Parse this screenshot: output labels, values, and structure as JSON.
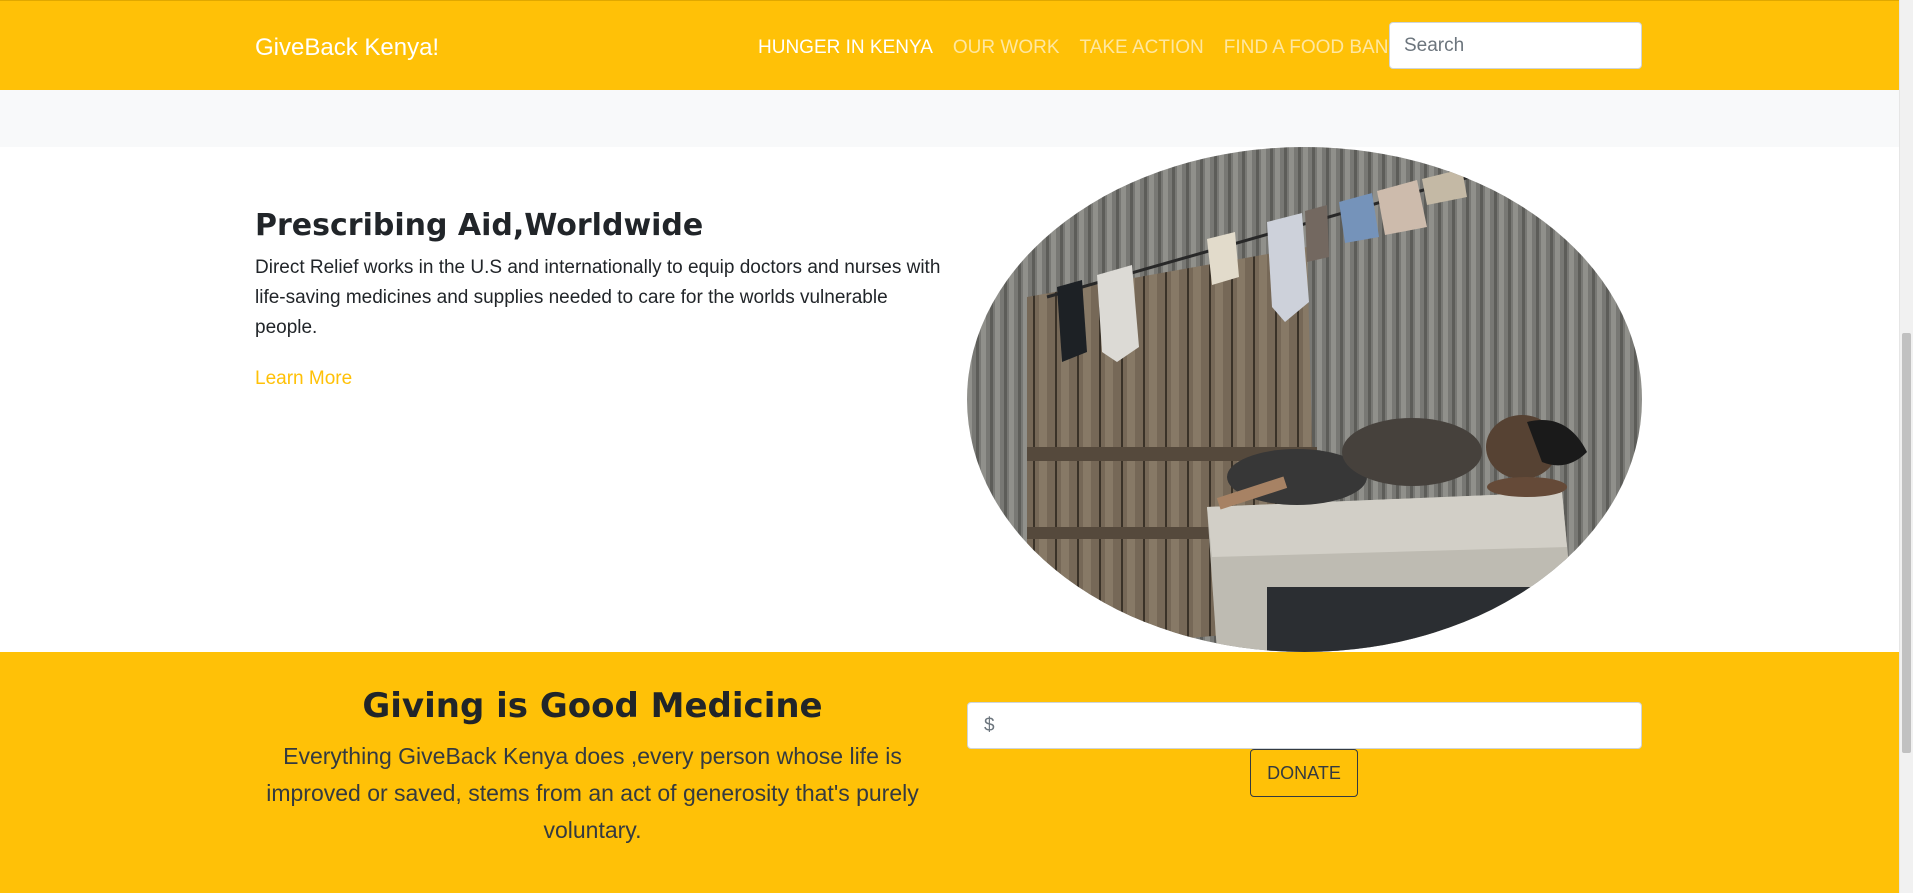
{
  "navbar": {
    "brand": "GiveBack Kenya!",
    "links": [
      {
        "label": "HUNGER IN KENYA",
        "active": true
      },
      {
        "label": "OUR WORK",
        "active": false
      },
      {
        "label": "TAKE ACTION",
        "active": false
      },
      {
        "label": "FIND A FOOD BANK",
        "active": false
      }
    ],
    "search_placeholder": "Search"
  },
  "feature": {
    "title": "Prescribing Aid,Worldwide",
    "text": "Direct Relief works in the U.S and internationally to equip doctors and nurses with life-saving medicines and supplies needed to care for the worlds vulnerable people.",
    "link_label": "Learn More"
  },
  "donate": {
    "title": "Giving is Good Medicine",
    "lead": "Everything GiveBack Kenya does ,every person whose life is improved or saved, stems from an act of generosity that's purely voluntary.",
    "amount_placeholder": "$",
    "button_label": "DONATE"
  },
  "colors": {
    "brand_yellow": "#ffc107",
    "page_bg": "#ffffff",
    "strip_bg": "#f8f9fa",
    "text_dark": "#212529"
  }
}
